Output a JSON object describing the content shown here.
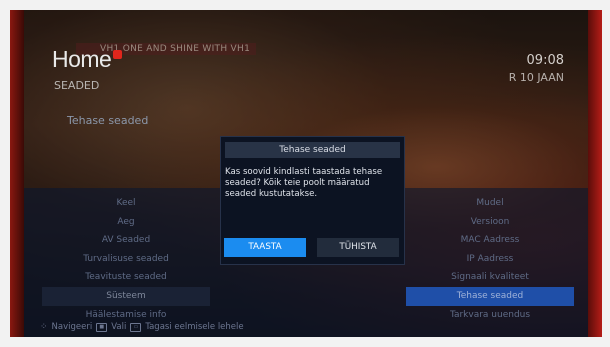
{
  "header": {
    "logo_text": "Home",
    "channel_banner": "VH1 ONE AND SHINE WITH VH1",
    "section": "SEADED",
    "current_item": "Tehase seaded",
    "time": "09:08",
    "date": "R 10 JAAN"
  },
  "menu_left": [
    {
      "label": "Keel"
    },
    {
      "label": "Aeg"
    },
    {
      "label": "AV Seaded"
    },
    {
      "label": "Turvalisuse seaded"
    },
    {
      "label": "Teavituste seaded"
    },
    {
      "label": "Süsteem"
    },
    {
      "label": "Häälestamise info"
    }
  ],
  "menu_right": [
    {
      "label": "Mudel"
    },
    {
      "label": "Versioon"
    },
    {
      "label": "MAC Aadress"
    },
    {
      "label": "IP Aadress"
    },
    {
      "label": "Signaali kvaliteet"
    },
    {
      "label": "Tehase seaded"
    },
    {
      "label": "Tarkvara uuendus"
    }
  ],
  "dialog": {
    "title": "Tehase seaded",
    "message": "Kas soovid kindlasti taastada tehase seaded? Kõik teie poolt määratud seaded kustutatakse.",
    "confirm_label": "TAASTA",
    "cancel_label": "TÜHISTA"
  },
  "footer": {
    "navigate_label": "Navigeeri",
    "select_label": "Vali",
    "back_label": "Tagasi eelmisele lehele"
  },
  "colors": {
    "confirm_button": "#1b8cf0",
    "selected_item": "#1f4fa8",
    "brand_red": "#e1261c"
  }
}
